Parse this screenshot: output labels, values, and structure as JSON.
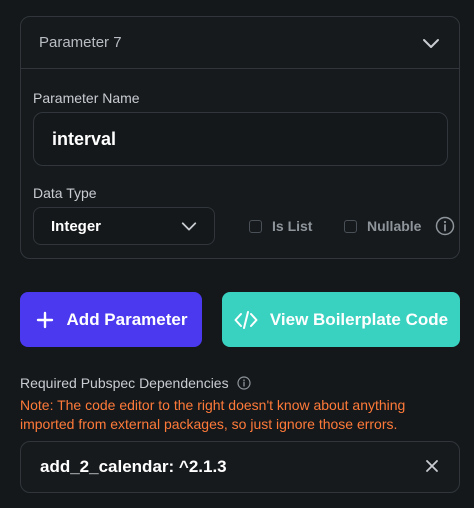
{
  "parameter": {
    "title": "Parameter 7",
    "name_label": "Parameter Name",
    "name_value": "interval",
    "type_label": "Data Type",
    "type_value": "Integer",
    "is_list_label": "Is List",
    "is_list_checked": false,
    "nullable_label": "Nullable",
    "nullable_checked": false
  },
  "buttons": {
    "add_parameter": "Add Parameter",
    "view_boilerplate": "View Boilerplate Code"
  },
  "dependencies": {
    "label": "Required Pubspec Dependencies",
    "note": "Note: The code editor to the right doesn't know about anything imported from external packages, so just ignore those errors.",
    "items": [
      "add_2_calendar: ^2.1.3"
    ]
  },
  "colors": {
    "background": "#14181b",
    "primary": "#4b39ef",
    "secondary": "#39d2c0",
    "warning": "#ff7a39",
    "border": "#30363b"
  }
}
